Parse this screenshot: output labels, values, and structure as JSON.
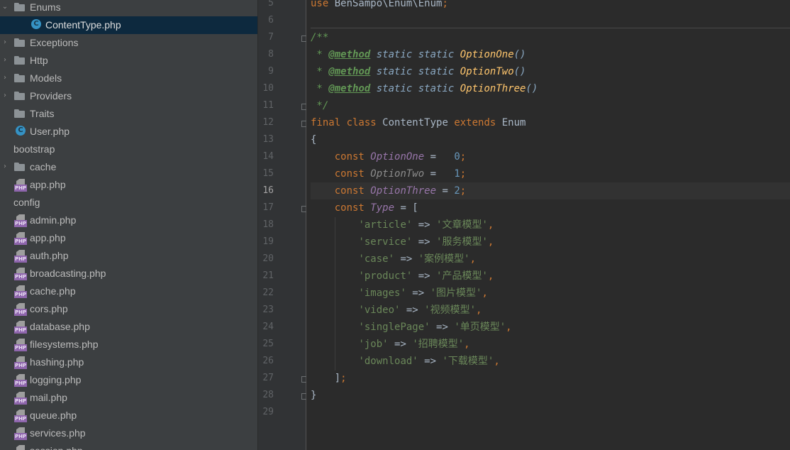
{
  "project_tree": {
    "items": [
      {
        "label": "Enums",
        "kind": "folder",
        "expanded": true,
        "arrow": "⌄"
      },
      {
        "label": "ContentType.php",
        "kind": "class",
        "selected": true
      },
      {
        "label": "Exceptions",
        "kind": "folder",
        "arrow": "›"
      },
      {
        "label": "Http",
        "kind": "folder",
        "arrow": "›"
      },
      {
        "label": "Models",
        "kind": "folder",
        "arrow": "›"
      },
      {
        "label": "Providers",
        "kind": "folder",
        "arrow": "›"
      },
      {
        "label": "Traits",
        "kind": "folder"
      },
      {
        "label": "User.php",
        "kind": "class"
      },
      {
        "label": "bootstrap",
        "kind": "folder",
        "expanded": true
      },
      {
        "label": "cache",
        "kind": "folder",
        "arrow": "›"
      },
      {
        "label": "app.php",
        "kind": "php"
      },
      {
        "label": "config",
        "kind": "folder",
        "expanded": true
      },
      {
        "label": "admin.php",
        "kind": "php"
      },
      {
        "label": "app.php",
        "kind": "php"
      },
      {
        "label": "auth.php",
        "kind": "php"
      },
      {
        "label": "broadcasting.php",
        "kind": "php"
      },
      {
        "label": "cache.php",
        "kind": "php"
      },
      {
        "label": "cors.php",
        "kind": "php"
      },
      {
        "label": "database.php",
        "kind": "php"
      },
      {
        "label": "filesystems.php",
        "kind": "php"
      },
      {
        "label": "hashing.php",
        "kind": "php"
      },
      {
        "label": "logging.php",
        "kind": "php"
      },
      {
        "label": "mail.php",
        "kind": "php"
      },
      {
        "label": "queue.php",
        "kind": "php"
      },
      {
        "label": "services.php",
        "kind": "php"
      },
      {
        "label": "session.php",
        "kind": "php"
      }
    ],
    "icons": {
      "folder": "folder-icon",
      "class": "php-class-icon",
      "php": "php-file-icon",
      "class_glyph": "C",
      "php_glyph": "PHP"
    }
  },
  "editor": {
    "current_line": 16,
    "lines": [
      {
        "n": 5,
        "tokens": [
          [
            "kw",
            "use "
          ],
          [
            "op",
            "BenSampo\\Enum\\Enum"
          ],
          [
            "kw",
            ";"
          ]
        ]
      },
      {
        "n": 6,
        "tokens": []
      },
      {
        "n": 7,
        "fold": true,
        "tokens": [
          [
            "cm",
            "/**"
          ]
        ]
      },
      {
        "n": 8,
        "tokens": [
          [
            "cm",
            " * "
          ],
          [
            "tag",
            "@method"
          ],
          [
            "cm",
            " "
          ],
          [
            "ty",
            "static static "
          ],
          [
            "mt",
            "OptionOne"
          ],
          [
            "ty",
            "()"
          ]
        ]
      },
      {
        "n": 9,
        "tokens": [
          [
            "cm",
            " * "
          ],
          [
            "tag",
            "@method"
          ],
          [
            "cm",
            " "
          ],
          [
            "ty",
            "static static "
          ],
          [
            "mt",
            "OptionTwo"
          ],
          [
            "ty",
            "()"
          ]
        ]
      },
      {
        "n": 10,
        "tokens": [
          [
            "cm",
            " * "
          ],
          [
            "tag",
            "@method"
          ],
          [
            "cm",
            " "
          ],
          [
            "ty",
            "static static "
          ],
          [
            "mt",
            "OptionThree"
          ],
          [
            "ty",
            "()"
          ]
        ]
      },
      {
        "n": 11,
        "fold": true,
        "tokens": [
          [
            "cm",
            " */"
          ]
        ]
      },
      {
        "n": 12,
        "fold": true,
        "tokens": [
          [
            "kw",
            "final class "
          ],
          [
            "op",
            "ContentType "
          ],
          [
            "kw",
            "extends "
          ],
          [
            "op",
            "Enum"
          ]
        ]
      },
      {
        "n": 13,
        "tokens": [
          [
            "op",
            "{"
          ]
        ]
      },
      {
        "n": 14,
        "tokens": [
          [
            "op",
            "    "
          ],
          [
            "kw",
            "const "
          ],
          [
            "cn",
            "OptionOne"
          ],
          [
            "op",
            " =   "
          ],
          [
            "num",
            "0"
          ],
          [
            "kw",
            ";"
          ]
        ]
      },
      {
        "n": 15,
        "tokens": [
          [
            "op",
            "    "
          ],
          [
            "kw",
            "const "
          ],
          [
            "cn2",
            "OptionTwo"
          ],
          [
            "op",
            " =   "
          ],
          [
            "num",
            "1"
          ],
          [
            "kw",
            ";"
          ]
        ]
      },
      {
        "n": 16,
        "bulb": true,
        "tokens": [
          [
            "op",
            "    "
          ],
          [
            "kw",
            "const "
          ],
          [
            "cn",
            "OptionThree"
          ],
          [
            "op",
            " = "
          ],
          [
            "num",
            "2"
          ],
          [
            "kw",
            ";"
          ]
        ]
      },
      {
        "n": 17,
        "fold": true,
        "tokens": [
          [
            "op",
            "    "
          ],
          [
            "kw",
            "const "
          ],
          [
            "cn",
            "Type"
          ],
          [
            "op",
            " = ["
          ]
        ]
      },
      {
        "n": 18,
        "tokens": [
          [
            "op",
            "        "
          ],
          [
            "str",
            "'article'"
          ],
          [
            "op",
            " => "
          ],
          [
            "str",
            "'文章模型'"
          ],
          [
            "kw",
            ","
          ]
        ]
      },
      {
        "n": 19,
        "tokens": [
          [
            "op",
            "        "
          ],
          [
            "str",
            "'service'"
          ],
          [
            "op",
            " => "
          ],
          [
            "str",
            "'服务模型'"
          ],
          [
            "kw",
            ","
          ]
        ]
      },
      {
        "n": 20,
        "tokens": [
          [
            "op",
            "        "
          ],
          [
            "str",
            "'case'"
          ],
          [
            "op",
            " => "
          ],
          [
            "str",
            "'案例模型'"
          ],
          [
            "kw",
            ","
          ]
        ]
      },
      {
        "n": 21,
        "tokens": [
          [
            "op",
            "        "
          ],
          [
            "str",
            "'product'"
          ],
          [
            "op",
            " => "
          ],
          [
            "str",
            "'产品模型'"
          ],
          [
            "kw",
            ","
          ]
        ]
      },
      {
        "n": 22,
        "tokens": [
          [
            "op",
            "        "
          ],
          [
            "str",
            "'images'"
          ],
          [
            "op",
            " => "
          ],
          [
            "str",
            "'图片模型'"
          ],
          [
            "kw",
            ","
          ]
        ]
      },
      {
        "n": 23,
        "tokens": [
          [
            "op",
            "        "
          ],
          [
            "str",
            "'video'"
          ],
          [
            "op",
            " => "
          ],
          [
            "str",
            "'视频模型'"
          ],
          [
            "kw",
            ","
          ]
        ]
      },
      {
        "n": 24,
        "tokens": [
          [
            "op",
            "        "
          ],
          [
            "str",
            "'singlePage'"
          ],
          [
            "op",
            " => "
          ],
          [
            "str",
            "'单页模型'"
          ],
          [
            "kw",
            ","
          ]
        ]
      },
      {
        "n": 25,
        "tokens": [
          [
            "op",
            "        "
          ],
          [
            "str",
            "'job'"
          ],
          [
            "op",
            " => "
          ],
          [
            "str",
            "'招聘模型'"
          ],
          [
            "kw",
            ","
          ]
        ]
      },
      {
        "n": 26,
        "tokens": [
          [
            "op",
            "        "
          ],
          [
            "str",
            "'download'"
          ],
          [
            "op",
            " => "
          ],
          [
            "str",
            "'下载模型'"
          ],
          [
            "kw",
            ","
          ]
        ]
      },
      {
        "n": 27,
        "fold": true,
        "tokens": [
          [
            "op",
            "    ]"
          ],
          [
            "kw",
            ";"
          ]
        ]
      },
      {
        "n": 28,
        "fold": true,
        "tokens": [
          [
            "op",
            "}"
          ]
        ]
      },
      {
        "n": 29,
        "tokens": []
      }
    ]
  },
  "colors": {
    "tree_bg": "#3c3f41",
    "tree_selected": "#0d293e",
    "editor_bg": "#2b2b2b",
    "keyword": "#cc7832",
    "string": "#6a8759",
    "number": "#6897bb",
    "constant": "#9876aa",
    "method": "#ffc66d"
  }
}
